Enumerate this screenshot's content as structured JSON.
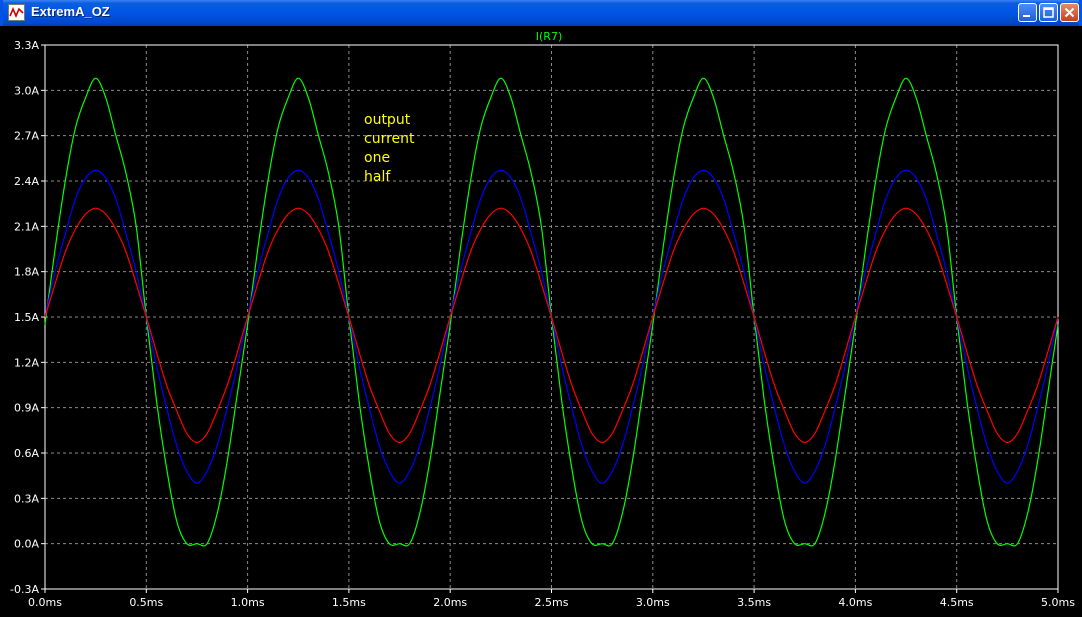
{
  "window": {
    "title": "ExtremA_OZ",
    "icon": "waveform-app-icon",
    "controls": [
      "minimize-icon",
      "maximize-icon",
      "close-icon"
    ]
  },
  "colors": {
    "background": "#000000",
    "axis": "#ffffff",
    "grid": "#888888",
    "tick_label": "#ffffff",
    "trace_title": "#00ff00",
    "annotation": "#ffff00"
  },
  "chart_data": {
    "type": "line",
    "title": "I(R7)",
    "xlabel": "",
    "ylabel": "",
    "xlim": [
      0,
      5.0
    ],
    "ylim": [
      -0.3,
      3.3
    ],
    "grid": true,
    "x_unit": "ms",
    "y_unit": "A",
    "xticks": [
      "0.0ms",
      "0.5ms",
      "1.0ms",
      "1.5ms",
      "2.0ms",
      "2.5ms",
      "3.0ms",
      "3.5ms",
      "4.0ms",
      "4.5ms",
      "5.0ms"
    ],
    "yticks": [
      "3.3A",
      "3.0A",
      "2.7A",
      "2.4A",
      "2.1A",
      "1.8A",
      "1.5A",
      "1.2A",
      "0.9A",
      "0.6A",
      "0.3A",
      "0.0A",
      "-0.3A"
    ],
    "annotation": [
      "output",
      "current",
      "one",
      "half"
    ],
    "series": [
      {
        "color": "#00ff00",
        "x": [
          0,
          0.05,
          0.1,
          0.15,
          0.2,
          0.25,
          0.3,
          0.35,
          0.4,
          0.45,
          0.5,
          0.55,
          0.6,
          0.65,
          0.7,
          0.75,
          0.8,
          0.85,
          0.9,
          0.95,
          1.0
        ],
        "y": [
          1.45,
          1.95,
          2.4,
          2.75,
          2.95,
          3.08,
          2.95,
          2.7,
          2.45,
          2.1,
          1.5,
          0.95,
          0.5,
          0.15,
          0.0,
          0.0,
          0.0,
          0.2,
          0.55,
          1.0,
          1.45
        ],
        "period": 1.0
      },
      {
        "color": "#0000ff",
        "x": [
          0,
          0.05,
          0.1,
          0.15,
          0.2,
          0.25,
          0.3,
          0.35,
          0.4,
          0.45,
          0.5,
          0.55,
          0.6,
          0.65,
          0.7,
          0.75,
          0.8,
          0.85,
          0.9,
          0.95,
          1.0
        ],
        "y": [
          1.5,
          1.8,
          2.05,
          2.28,
          2.42,
          2.47,
          2.42,
          2.28,
          2.05,
          1.8,
          1.5,
          1.18,
          0.9,
          0.65,
          0.48,
          0.4,
          0.48,
          0.65,
          0.9,
          1.18,
          1.5
        ],
        "period": 1.0
      },
      {
        "color": "#ff0000",
        "x": [
          0,
          0.05,
          0.1,
          0.15,
          0.2,
          0.25,
          0.3,
          0.35,
          0.4,
          0.45,
          0.5,
          0.55,
          0.6,
          0.65,
          0.7,
          0.75,
          0.8,
          0.85,
          0.9,
          0.95,
          1.0
        ],
        "y": [
          1.5,
          1.72,
          1.93,
          2.08,
          2.18,
          2.22,
          2.18,
          2.08,
          1.93,
          1.72,
          1.5,
          1.27,
          1.05,
          0.88,
          0.73,
          0.67,
          0.73,
          0.88,
          1.05,
          1.27,
          1.5
        ],
        "period": 1.0
      }
    ]
  }
}
